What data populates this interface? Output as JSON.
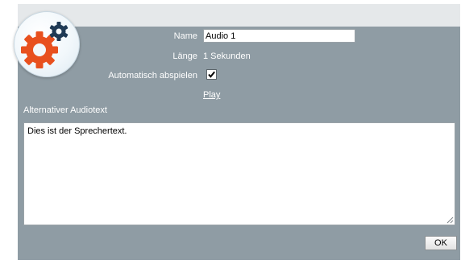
{
  "form": {
    "name_label": "Name",
    "name_value": "Audio 1",
    "duration_label": "Länge",
    "duration_value": "1 Sekunden",
    "autoplay_label": "Automatisch abspielen",
    "autoplay_checked": true,
    "play_link": "Play",
    "alt_text_label": "Alternativer Audiotext",
    "alt_text_value": "Dies ist der Sprechertext."
  },
  "buttons": {
    "ok_label": "OK"
  },
  "icons": {
    "logo": "gears-icon",
    "checkbox": "checkmark-icon",
    "grip": "resize-grip-icon"
  },
  "colors": {
    "panel_background": "#8f9ca4",
    "header_strip": "#e5e8ea",
    "large_gear": "#e8501e",
    "small_gear": "#1f3a55"
  }
}
